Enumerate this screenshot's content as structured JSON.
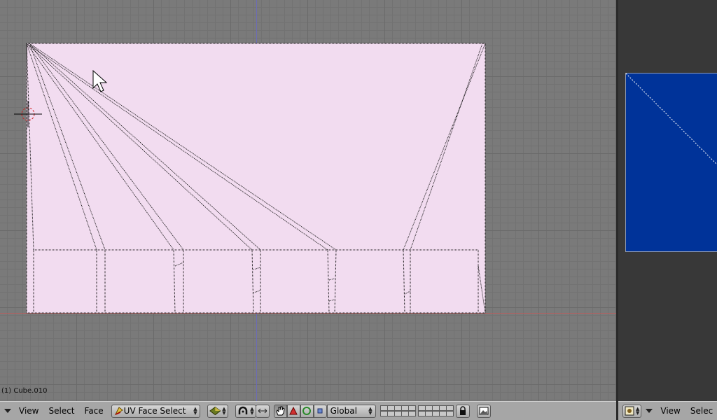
{
  "viewport": {
    "object_label": "(1) Cube.010"
  },
  "header_left": {
    "menus": [
      "View",
      "Select",
      "Face"
    ],
    "mode_select": "UV Face Select",
    "orientation": "Global"
  },
  "header_right": {
    "menus": [
      "View",
      "Selec"
    ]
  },
  "colors": {
    "uv_face_fill": "#f2dcf0",
    "image_face_fill": "#003399",
    "axis_x": "#b46060",
    "axis_y": "#6b6bb8",
    "header_bg": "#a6a6a6"
  },
  "icons": [
    "mode-icon",
    "shading-icon",
    "pivot-icon",
    "manipulator-hand-icon",
    "translate-icon",
    "rotate-icon",
    "scale-icon",
    "lock-icon",
    "render-icon",
    "image-editor-icon"
  ]
}
